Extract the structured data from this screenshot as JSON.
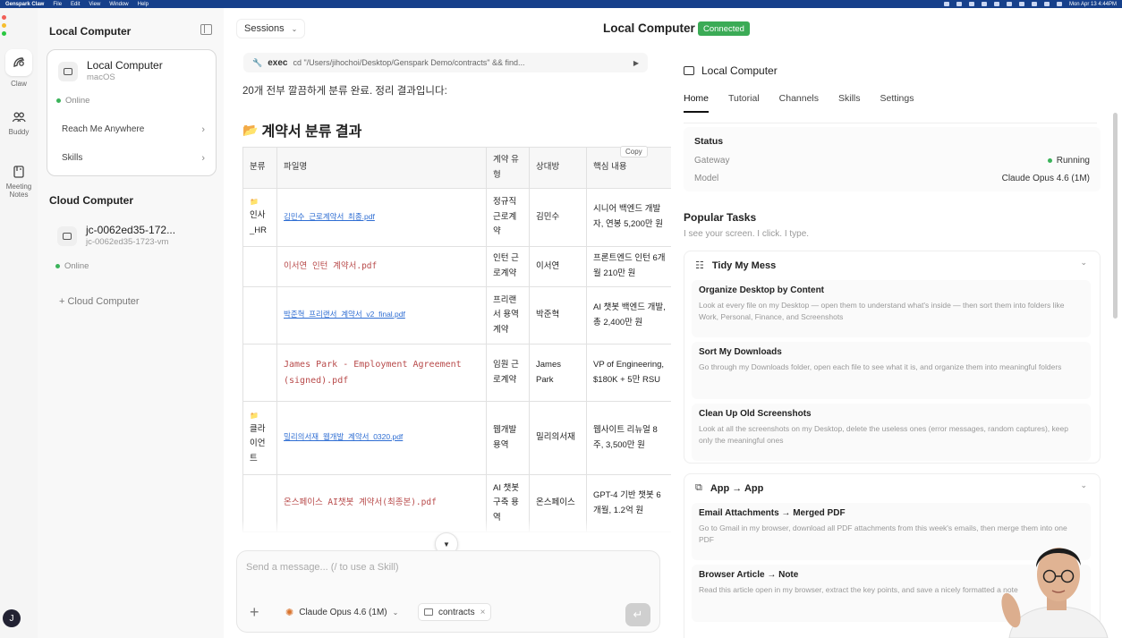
{
  "menubar": {
    "app": "Genspark Claw",
    "menus": [
      "File",
      "Edit",
      "View",
      "Window",
      "Help"
    ],
    "clock": "Mon Apr 13 4:44PM"
  },
  "rail": {
    "items": [
      {
        "label": "Claw",
        "icon": "claw-icon"
      },
      {
        "label": "Buddy",
        "icon": "people-icon"
      },
      {
        "label": "Meeting Notes",
        "label_lines": [
          "Meeting",
          "Notes"
        ],
        "icon": "notes-icon"
      }
    ],
    "avatar_initial": "J"
  },
  "sidebar": {
    "local_heading": "Local Computer",
    "local_machine": {
      "name": "Local Computer",
      "os": "macOS",
      "status": "Online"
    },
    "links": [
      {
        "label": "Reach Me Anywhere"
      },
      {
        "label": "Skills"
      }
    ],
    "cloud_heading": "Cloud Computer",
    "cloud_machine": {
      "name": "jc-0062ed35-172...",
      "id": "jc-0062ed35-1723-vm",
      "status": "Online"
    },
    "add_cloud": "+ Cloud Computer"
  },
  "header": {
    "sessions_label": "Sessions",
    "title": "Local Computer",
    "status_badge": "Connected"
  },
  "chat": {
    "exec_label": "exec",
    "exec_command": "cd \"/Users/jihochoi/Desktop/Genspark Demo/contracts\" && find...",
    "summary": "20개 전부 깔끔하게 분류 완료. 정리 결과입니다:",
    "result_title": "계약서 분류 결과",
    "copy_label": "Copy",
    "table": {
      "headers": [
        "분류",
        "파일명",
        "계약 유형",
        "상대방",
        "핵심 내용"
      ],
      "rows": [
        {
          "category": "인사_HR",
          "file": "김민수_근로계약서_최종.pdf",
          "type": "정규직 근로계약",
          "party": "김민수",
          "summary": "시니어 백엔드 개발자, 연봉 5,200만 원"
        },
        {
          "category": "",
          "file": "이서연 인턴 계약서.pdf",
          "type": "인턴 근로계약",
          "party": "이서연",
          "summary": "프론트엔드 인턴 6개월 210만 원"
        },
        {
          "category": "",
          "file": "박준혁_프리랜서_계약서_v2_final.pdf",
          "type": "프리랜서 용역 계약",
          "party": "박준혁",
          "summary": "AI 챗봇 백엔드 개발, 총 2,400만 원"
        },
        {
          "category": "",
          "file": "James Park - Employment Agreement (signed).pdf",
          "type": "임원 근로계약",
          "party": "James Park",
          "summary": "VP of Engineering, $180K + 5만 RSU"
        },
        {
          "category": "클라이언트",
          "file": "밀리의서재_웹개발_계약서_0320.pdf",
          "type": "웹개발 용역",
          "party": "밀리의서재",
          "summary": "웹사이트 리뉴얼 8주, 3,500만 원"
        },
        {
          "category": "",
          "file": "온스페이스 AI챗봇 계약서(최종본).pdf",
          "type": "AI 챗봇 구축 용역",
          "party": "온스페이스",
          "summary": "GPT-4 기반 챗봇 6개월, 1.2억 원"
        }
      ]
    },
    "composer": {
      "placeholder": "Send a message... (/ to use a Skill)",
      "model": "Claude Opus 4.6 (1M)",
      "context_folder": "contracts"
    }
  },
  "panel": {
    "title": "Local Computer",
    "tabs": [
      "Home",
      "Tutorial",
      "Channels",
      "Skills",
      "Settings"
    ],
    "active_tab": "Home",
    "status": {
      "heading": "Status",
      "gateway_label": "Gateway",
      "gateway_value": "Running",
      "model_label": "Model",
      "model_value": "Claude Opus 4.6 (1M)"
    },
    "popular": {
      "title": "Popular Tasks",
      "subtitle": "I see your screen. I click. I type.",
      "groups": [
        {
          "name": "Tidy My Mess",
          "tasks": [
            {
              "title": "Organize Desktop by Content",
              "desc": "Look at every file on my Desktop — open them to understand what's inside — then sort them into folders like Work, Personal, Finance, and Screenshots"
            },
            {
              "title": "Sort My Downloads",
              "desc": "Go through my Downloads folder, open each file to see what it is, and organize them into meaningful folders"
            },
            {
              "title": "Clean Up Old Screenshots",
              "desc": "Look at all the screenshots on my Desktop, delete the useless ones (error messages, random captures), keep only the meaningful ones"
            }
          ]
        },
        {
          "name": "App → App",
          "tasks": [
            {
              "title": "Email Attachments → Merged PDF",
              "desc": "Go to Gmail in my browser, download all PDF attachments from this week's emails, then merge them into one PDF"
            },
            {
              "title": "Browser Article → Note",
              "desc": "Read this article open in my browser, extract the key points, and save a nicely formatted a note"
            }
          ]
        }
      ]
    }
  },
  "colors": {
    "accent_green": "#3bab56",
    "menubar_blue": "#16408b",
    "file_red": "#b84a4a",
    "link_blue": "#2f6ed3"
  }
}
